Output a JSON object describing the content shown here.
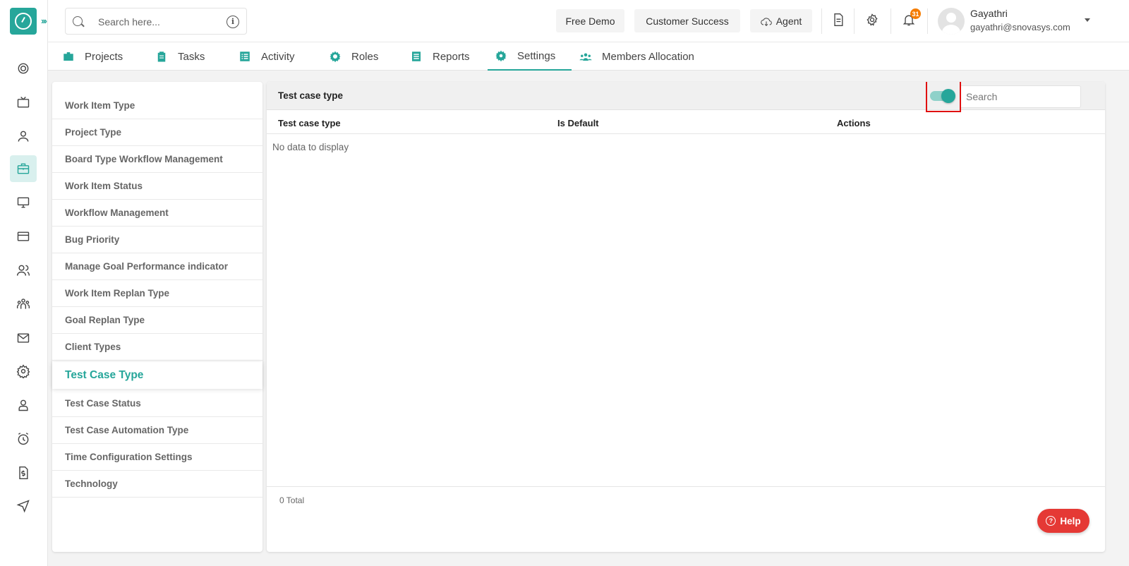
{
  "topbar": {
    "search_placeholder": "Search here...",
    "free_demo": "Free Demo",
    "customer_success": "Customer Success",
    "agent": "Agent",
    "notification_count": "31",
    "user_name": "Gayathri",
    "user_email": "gayathri@snovasys.com"
  },
  "tabs": [
    {
      "label": "Projects"
    },
    {
      "label": "Tasks"
    },
    {
      "label": "Activity"
    },
    {
      "label": "Roles"
    },
    {
      "label": "Reports"
    },
    {
      "label": "Settings"
    },
    {
      "label": "Members Allocation"
    }
  ],
  "side_menu": [
    {
      "label": "Work Item Type"
    },
    {
      "label": "Project Type"
    },
    {
      "label": "Board Type Workflow Management"
    },
    {
      "label": "Work Item Status"
    },
    {
      "label": "Workflow Management"
    },
    {
      "label": "Bug Priority"
    },
    {
      "label": "Manage Goal Performance indicator"
    },
    {
      "label": "Work Item Replan Type"
    },
    {
      "label": "Goal Replan Type"
    },
    {
      "label": "Client Types"
    },
    {
      "label": "Test Case Type"
    },
    {
      "label": "Test Case Status"
    },
    {
      "label": "Test Case Automation Type"
    },
    {
      "label": "Time Configuration Settings"
    },
    {
      "label": "Technology"
    }
  ],
  "panel": {
    "title": "Test case type",
    "search_placeholder": "Search",
    "columns": [
      "Test case type",
      "Is Default",
      "Actions"
    ],
    "empty_text": "No data to display",
    "total": "0 Total"
  },
  "help_label": "Help",
  "colors": {
    "accent": "#26a69a",
    "highlight": "#e01010",
    "help": "#e53935",
    "badge": "#f57c00"
  }
}
